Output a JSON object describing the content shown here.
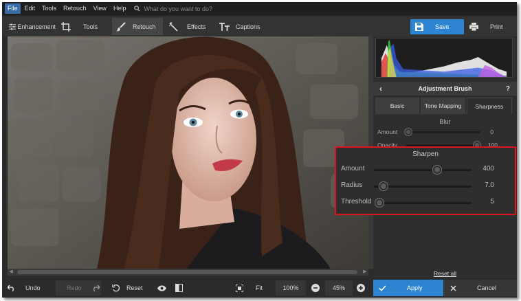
{
  "menu": [
    "File",
    "Edit",
    "Tools",
    "Retouch",
    "View",
    "Help"
  ],
  "search": {
    "placeholder": "What do you want to do?"
  },
  "tabs": [
    {
      "label": "Enhancement",
      "icon": "sliders-icon"
    },
    {
      "label": "Tools",
      "icon": "crop-icon"
    },
    {
      "label": "Retouch",
      "icon": "brush-icon",
      "active": true
    },
    {
      "label": "Effects",
      "icon": "magic-wand-icon"
    },
    {
      "label": "Captions",
      "icon": "text-icon"
    }
  ],
  "save_label": "Save",
  "print_label": "Print",
  "panel": {
    "title": "Adjustment Brush",
    "back_icon": "chevron-left-icon",
    "help": "?",
    "tabs": [
      "Basic",
      "Tone Mapping",
      "Sharpness"
    ],
    "active_tab": "Sharpness",
    "blur": {
      "title": "Blur",
      "amount": {
        "label": "Amount",
        "value": "0",
        "fraction": 0.0
      },
      "opacity": {
        "label": "Opacity",
        "value": "100",
        "fraction": 1.0
      }
    },
    "sharpen": {
      "title": "Sharpen",
      "amount": {
        "label": "Amount",
        "value": "400",
        "fraction": 0.66
      },
      "radius": {
        "label": "Radius",
        "value": "7.0",
        "fraction": 0.1
      },
      "threshold": {
        "label": "Threshold",
        "value": "5",
        "fraction": 0.05
      }
    },
    "reset_all": "Reset all"
  },
  "bottom": {
    "undo": "Undo",
    "redo": "Redo",
    "reset": "Reset",
    "fit": "Fit",
    "zoom_100": "100%",
    "zoom_value": "45%",
    "apply": "Apply",
    "cancel": "Cancel"
  },
  "colors": {
    "accent": "#2d84d0",
    "highlight": "#e0141e"
  }
}
